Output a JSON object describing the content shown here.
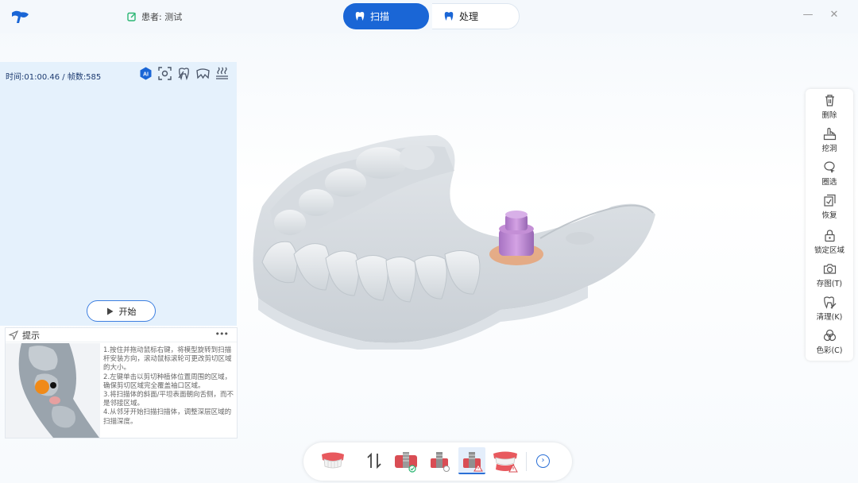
{
  "titlebar": {
    "patient_label": "患者: 测试",
    "tabs": [
      {
        "label": "扫描",
        "active": true
      },
      {
        "label": "处理",
        "active": false
      }
    ],
    "minimize": "—",
    "close": "✕"
  },
  "scan_panel": {
    "stats": "时间:01:00.46 / 帧数:585",
    "ai_badge": "AI",
    "start_label": "开始"
  },
  "hint": {
    "title": "提示",
    "more": "•••",
    "text": "1.按住并拖动鼠标右键，将模型旋转到扫描杆安装方向，滚动鼠标滚轮可更改剪切区域的大小。\n2.左键单击以剪切种植体位置周围的区域，确保剪切区域完全覆盖袖口区域。\n3.将扫描体的斜面/平坦表面朝向舌侧，而不是邻接区域。\n4.从邻牙开始扫描扫描体，调整深层区域的扫描深度。"
  },
  "right_toolbar": [
    {
      "label": "删除",
      "icon": "trash-icon"
    },
    {
      "label": "挖洞",
      "icon": "dig-hole-icon"
    },
    {
      "label": "圈选",
      "icon": "lasso-icon"
    },
    {
      "label": "恢复",
      "icon": "restore-icon"
    },
    {
      "label": "锁定区域",
      "icon": "lock-icon"
    },
    {
      "label": "存图(T)",
      "icon": "camera-icon"
    },
    {
      "label": "清理(K)",
      "icon": "clean-icon"
    },
    {
      "label": "色彩(C)",
      "icon": "color-icon"
    }
  ],
  "bottom_toolbar": {
    "items": [
      "upper-jaw-icon",
      "swap-jaw-icon",
      "scanbody-check-icon",
      "scanbody-icon",
      "scanbody-warning-icon",
      "full-arch-warning-icon"
    ],
    "next": "›"
  },
  "colors": {
    "accent": "#1a66d6",
    "panel": "#e5f1fc",
    "scanbody": "#c48fd6",
    "gingiva_ring": "#e8a070"
  }
}
